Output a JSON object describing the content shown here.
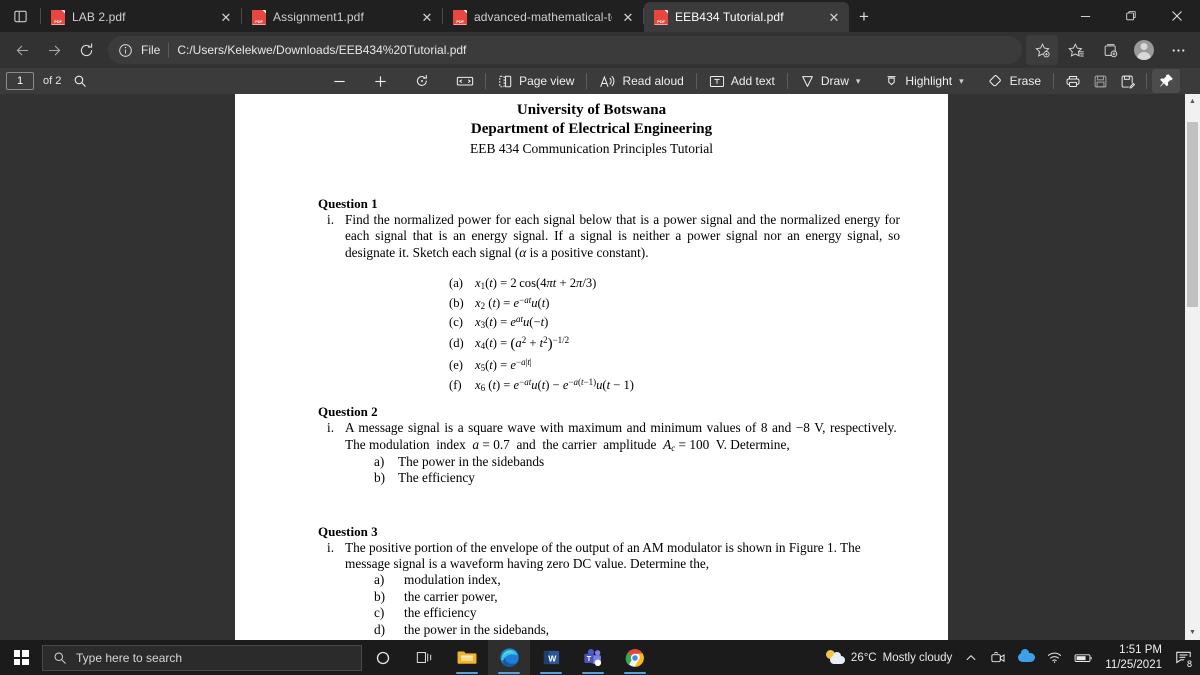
{
  "browser": {
    "tabs": [
      {
        "title": "LAB 2.pdf",
        "icon": "pdf-icon",
        "active": false
      },
      {
        "title": "Assignment1.pdf",
        "icon": "pdf-icon",
        "active": false
      },
      {
        "title": "advanced-mathematical-techniq",
        "icon": "pdf-icon",
        "active": false
      },
      {
        "title": "EEB434 Tutorial.pdf",
        "icon": "pdf-icon",
        "active": true
      }
    ],
    "new_tab_label": "+",
    "close_label": "✕",
    "window_controls": {
      "minimize": "─",
      "maximize": "❐",
      "close": "✕"
    },
    "address": {
      "scheme_label": "File",
      "url": "C:/Users/Kelekwe/Downloads/EEB434%20Tutorial.pdf",
      "info_icon": "info-icon"
    },
    "nav_icons": [
      "back-icon",
      "forward-icon",
      "refresh-icon"
    ],
    "right_icons": [
      "add-favorite-icon",
      "favorites-icon",
      "collections-icon",
      "profile-avatar",
      "settings-more-icon"
    ]
  },
  "pdf_toolbar": {
    "page_number": "1",
    "page_count": "of 2",
    "search_icon": "search-icon",
    "zoom_out": "−",
    "zoom_in": "+",
    "rotate_label": "rotate-icon",
    "fit_label": "fit-to-width-icon",
    "page_view": "Page view",
    "read_aloud": "Read aloud",
    "add_text": "Add text",
    "draw": "Draw",
    "highlight": "Highlight",
    "erase": "Erase",
    "print_icon": "print-icon",
    "save_icon": "save-icon",
    "save_as_icon": "save-as-icon",
    "pin_icon": "pin-icon"
  },
  "document": {
    "header": {
      "line1": "University of Botswana",
      "line2": "Department of Electrical Engineering",
      "line3": "EEB 434 Communication Principles Tutorial"
    },
    "question1": {
      "heading": "Question 1",
      "number": "i.",
      "text": "Find the normalized power for each signal below that is a power signal and the normalized energy for each signal that is an energy signal. If a signal is neither a power signal nor an energy signal, so designate it. Sketch each signal (α is a positive constant).",
      "equations": [
        {
          "label": "(a)",
          "html": "x₁(t) = 2cos(4πt + 2π/3)"
        },
        {
          "label": "(b)",
          "html": "x₂(t) = e⁻ᵃᵗu(t)"
        },
        {
          "label": "(c)",
          "html": "x₃(t) = eᵃᵗu(−t)"
        },
        {
          "label": "(d)",
          "html": "x₄(t) = (α² + t²)⁻¹ᐟ²"
        },
        {
          "label": "(e)",
          "html": "x₅(t) = e⁻ᵃ|t|"
        },
        {
          "label": "(f)",
          "html": "x₆(t) = e⁻ᵃᵗu(t) − e⁻ᵃ⁽ᵗ⁻¹⁾u(t − 1)"
        }
      ]
    },
    "question2": {
      "heading": "Question 2",
      "number": "i.",
      "text": "A message signal is a square wave with maximum and minimum values of 8 and −8 V, respectively.  The modulation  index  a = 0.7  and  the carrier  amplitude  Ac = 100  V. Determine,",
      "items": [
        {
          "label": "a)",
          "text": "The power in the sidebands"
        },
        {
          "label": "b)",
          "text": "The efficiency"
        }
      ]
    },
    "question3": {
      "heading": "Question 3",
      "number": "i.",
      "text": "The positive portion of the envelope of the output of an AM modulator is shown in Figure 1. The message signal is a waveform having zero DC value. Determine the,",
      "items": [
        {
          "label": "a)",
          "text": "modulation index,"
        },
        {
          "label": "b)",
          "text": "the carrier power,"
        },
        {
          "label": "c)",
          "text": "the efficiency"
        },
        {
          "label": "d)",
          "text": "the power in the sidebands,"
        }
      ]
    }
  },
  "taskbar": {
    "start_icon": "windows-start-icon",
    "search_placeholder": "Type here to search",
    "search_icon": "search-icon",
    "cortana_icon": "cortana-circle-icon",
    "taskview_icon": "task-view-icon",
    "apps": [
      "file-explorer-icon",
      "microsoft-edge-icon",
      "microsoft-word-icon",
      "microsoft-teams-icon",
      "google-chrome-icon"
    ],
    "tray": {
      "weather_temp": "26°C",
      "weather_desc": "Mostly cloudy",
      "chevron": "⌃",
      "icons": [
        "meet-now-icon",
        "onedrive-icon",
        "wifi-icon",
        "battery-icon"
      ],
      "time": "1:51 PM",
      "date": "11/25/2021",
      "notification_count": "8"
    }
  },
  "colors": {
    "tabstrip_bg": "#202020",
    "navbar_bg": "#323232",
    "active_tab_bg": "#3b3b3b",
    "pdf_toolbar_bg": "#3b3b3b",
    "viewer_bg": "#323232",
    "page_bg": "#ffffff",
    "taskbar_bg": "#1b1b1b",
    "pdf_red": "#e8473f",
    "accent_blue": "#4fa3e3"
  }
}
